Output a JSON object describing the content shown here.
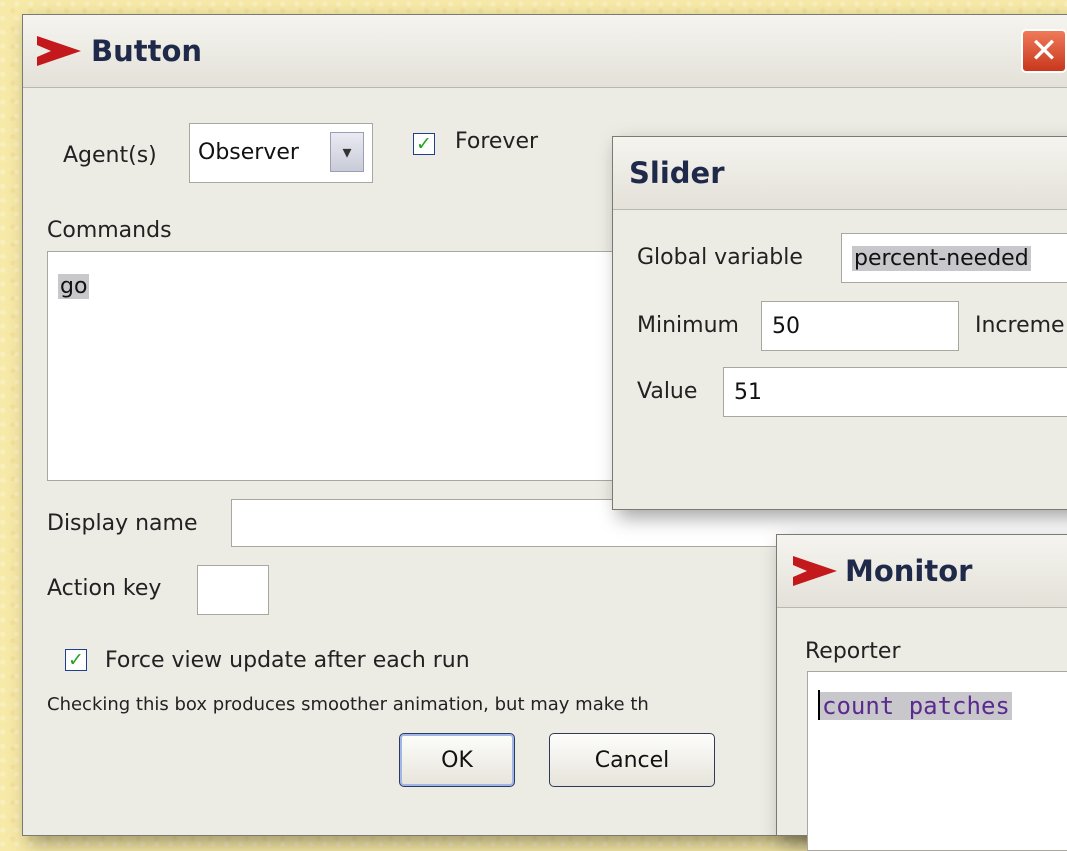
{
  "button_dialog": {
    "title": "Button",
    "agents_label": "Agent(s)",
    "agents_value": "Observer",
    "forever_label": "Forever",
    "forever_checked": true,
    "commands_label": "Commands",
    "commands_value": "go",
    "display_name_label": "Display name",
    "display_name_value": "",
    "action_key_label": "Action key",
    "action_key_value": "",
    "force_update_label": "Force view update after each run",
    "force_update_checked": true,
    "hint_text": "Checking this box produces smoother animation, but may make th",
    "ok_label": "OK",
    "cancel_label": "Cancel"
  },
  "slider_dialog": {
    "title": "Slider",
    "global_variable_label": "Global variable",
    "global_variable_value": "percent-needed",
    "minimum_label": "Minimum",
    "minimum_value": "50",
    "increment_label": "Increme",
    "value_label": "Value",
    "value_value": "51"
  },
  "monitor_dialog": {
    "title": "Monitor",
    "reporter_label": "Reporter",
    "reporter_value": "count patches"
  },
  "colors": {
    "background": "#f7eaa8",
    "title_text": "#1f2a4a",
    "close_button": "#d9472b",
    "checkmark": "#21a321",
    "reporter_code": "#5b2a8f"
  }
}
